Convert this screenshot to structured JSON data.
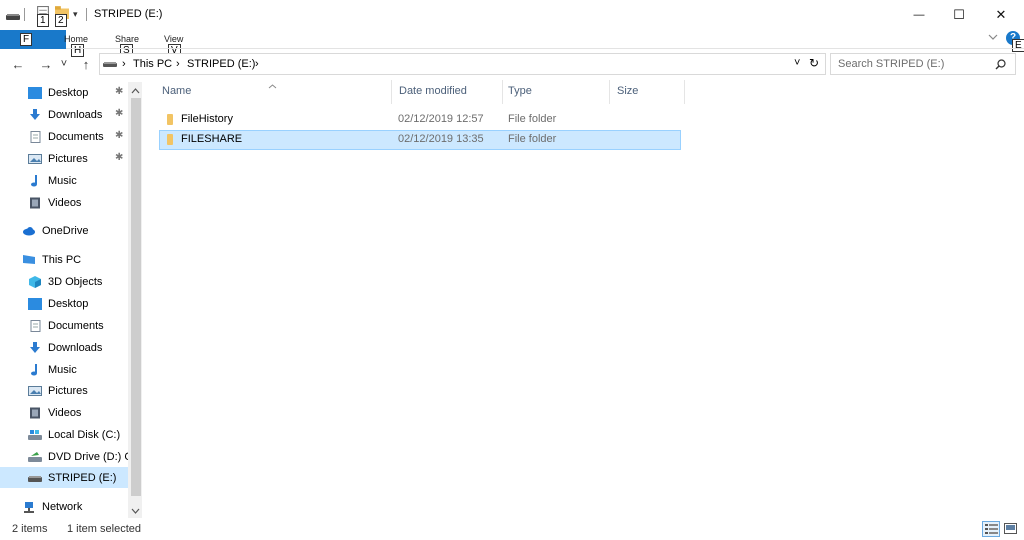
{
  "titlebar": {
    "title": "STRIPED (E:)",
    "quick_access": {
      "key1": "1",
      "key2": "2",
      "dropdown": "▾"
    },
    "controls": {
      "minimize": "—",
      "maximize": "☐",
      "close": "✕"
    }
  },
  "ribbon": {
    "file_key": "F",
    "tabs": [
      {
        "label": "Home",
        "key": "H"
      },
      {
        "label": "Share",
        "key": "S"
      },
      {
        "label": "View",
        "key": "V"
      }
    ],
    "expand_icon": "chevron-down-icon",
    "help_key": "E",
    "help_badge": "?"
  },
  "navigation": {
    "back": "←",
    "forward": "→",
    "recent": "˅",
    "up": "↑",
    "path": [
      "This PC",
      "STRIPED (E:)"
    ],
    "separator": "›",
    "dropdown": "˅",
    "refresh": "↻",
    "search_placeholder": "Search STRIPED (E:)"
  },
  "nav_pane": {
    "quick_access": [
      {
        "label": "Desktop",
        "icon": "desktop-icon",
        "pinned": true
      },
      {
        "label": "Downloads",
        "icon": "download-arrow-icon",
        "pinned": true
      },
      {
        "label": "Documents",
        "icon": "documents-icon",
        "pinned": true
      },
      {
        "label": "Pictures",
        "icon": "pictures-icon",
        "pinned": true
      },
      {
        "label": "Music",
        "icon": "music-note-icon",
        "pinned": false
      },
      {
        "label": "Videos",
        "icon": "videos-icon",
        "pinned": false
      }
    ],
    "onedrive": "OneDrive",
    "this_pc": "This PC",
    "this_pc_items": [
      {
        "label": "3D Objects",
        "icon": "3d-objects-icon"
      },
      {
        "label": "Desktop",
        "icon": "desktop-icon"
      },
      {
        "label": "Documents",
        "icon": "documents-icon"
      },
      {
        "label": "Downloads",
        "icon": "download-arrow-icon"
      },
      {
        "label": "Music",
        "icon": "music-note-icon"
      },
      {
        "label": "Pictures",
        "icon": "pictures-icon"
      },
      {
        "label": "Videos",
        "icon": "videos-icon"
      },
      {
        "label": "Local Disk (C:)",
        "icon": "local-disk-icon"
      },
      {
        "label": "DVD Drive (D:) C",
        "icon": "dvd-drive-icon"
      },
      {
        "label": "STRIPED (E:)",
        "icon": "drive-icon",
        "selected": true
      }
    ],
    "network": "Network",
    "pin_glyph": "✱"
  },
  "file_list": {
    "columns": [
      "Name",
      "Date modified",
      "Type",
      "Size"
    ],
    "rows": [
      {
        "name": "FileHistory",
        "date": "02/12/2019 12:57",
        "type": "File folder",
        "size": "",
        "selected": false
      },
      {
        "name": "FILESHARE",
        "date": "02/12/2019 13:35",
        "type": "File folder",
        "size": "",
        "selected": true
      }
    ]
  },
  "status": {
    "item_count": "2 items",
    "selection": "1 item selected"
  },
  "colors": {
    "accent": "#1979ca",
    "selection_bg": "#cce8ff",
    "selection_border": "#99d1ff",
    "folder": "#f2c464"
  }
}
